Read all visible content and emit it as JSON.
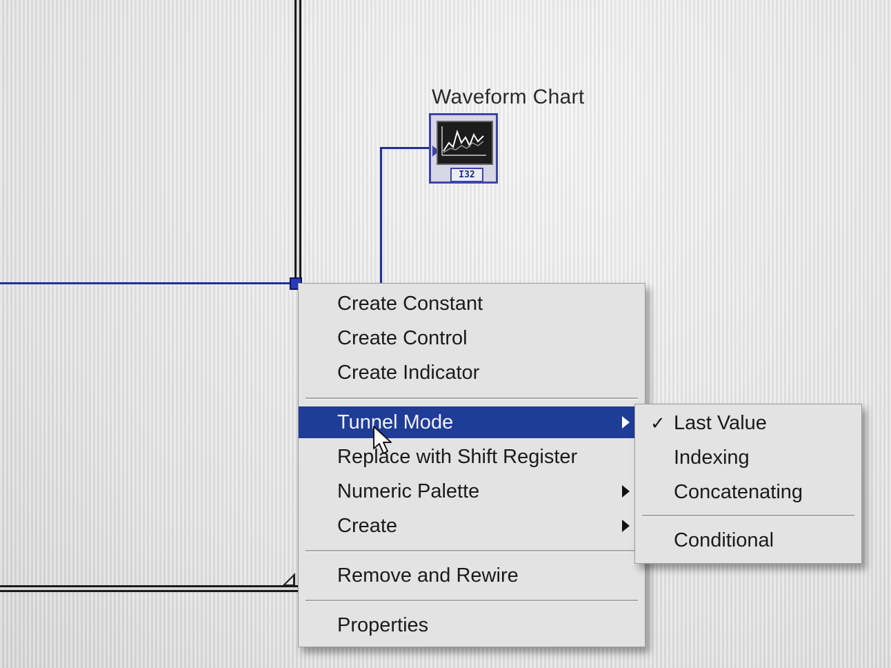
{
  "chart_terminal": {
    "label": "Waveform Chart",
    "dtype": "I32",
    "icon": "waveform-chart-icon"
  },
  "context_menu": {
    "items": [
      {
        "label": "Create Constant",
        "submenu": false
      },
      {
        "label": "Create Control",
        "submenu": false
      },
      {
        "label": "Create Indicator",
        "submenu": false
      },
      {
        "label": "Tunnel Mode",
        "submenu": true,
        "highlighted": true
      },
      {
        "label": "Replace with Shift Register",
        "submenu": false
      },
      {
        "label": "Numeric Palette",
        "submenu": true
      },
      {
        "label": "Create",
        "submenu": true
      },
      {
        "label": "Remove and Rewire",
        "submenu": false
      },
      {
        "label": "Properties",
        "submenu": false
      }
    ]
  },
  "tunnel_mode_submenu": {
    "items": [
      {
        "label": "Last Value",
        "checked": true,
        "check_glyph": "✓"
      },
      {
        "label": "Indexing",
        "checked": false
      },
      {
        "label": "Concatenating",
        "checked": false
      },
      {
        "label": "Conditional",
        "checked": false
      }
    ]
  },
  "colors": {
    "wire": "#1f2f9a",
    "highlight": "#1f3c96",
    "menu_bg": "#e3e3e3"
  }
}
